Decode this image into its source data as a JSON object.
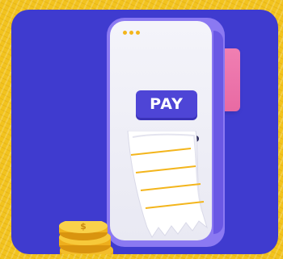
{
  "pay_button": {
    "label": "PAY"
  },
  "colors": {
    "background": "#f2c31e",
    "card": "#3f3bcf",
    "phone_body": "#8b79f2",
    "screen": "#f0f0f7",
    "pay_button": "#4e45d6",
    "pink_card": "#f07fb2",
    "coin": "#f3b51c"
  },
  "icons": [
    "window-dots-icon",
    "receipt-icon",
    "coin-stack-icon",
    "dollar-icon"
  ]
}
